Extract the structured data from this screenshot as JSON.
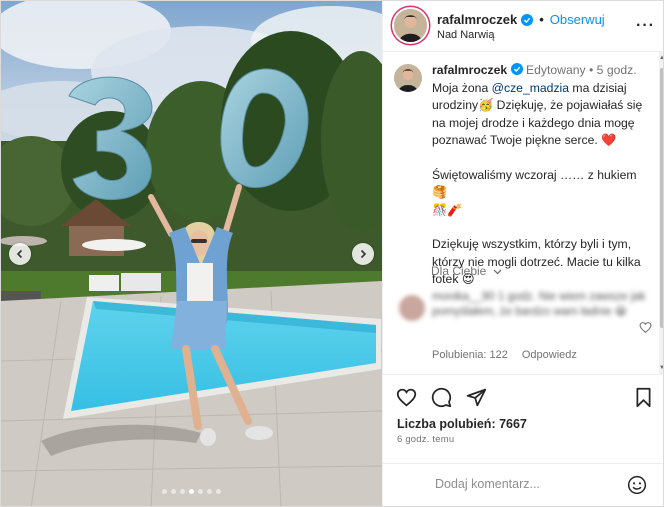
{
  "post": {
    "username": "rafalmroczek",
    "follow_label": "Obserwuj",
    "location": "Nad Narwią",
    "more_label": "···"
  },
  "caption": {
    "username": "rafalmroczek",
    "edited_label": "Edytowany",
    "time": "5 godz.",
    "line1_pre": "Moja żona ",
    "mention": "@cze_madzia",
    "line1_post": " ma dzisiaj urodziny",
    "emoji_birthday": "🥳",
    "line1_rest": " Dziękuję, że pojawiałaś się na mojej drodze i każdego dnia mogę poznawać Twoje piękne serce. ",
    "emoji_heart": "❤️",
    "para2": "Świętowaliśmy wczoraj …… z hukiem ",
    "emoji_cake": "🥞",
    "emoji_party": "🎊",
    "emoji_firecracker": "🧨",
    "para3": "Dziękuję wszystkim, którzy byli i tym, którzy nie mogli dotrzeć. Macie tu kilka fotek ",
    "emoji_smile": "😍"
  },
  "for_you_label": "Dla Ciebie",
  "comment2": {
    "text": "monika__90 1 godz. Nie wiem zawsze jak pomyślałem, że bardzo wam ładnie",
    "emoji": "😀",
    "likes_label": "Polubienia: 122",
    "reply_label": "Odpowiedz"
  },
  "likes": "Liczba polubień: 7667",
  "timestamp": "6 godz. temu",
  "comment_input": {
    "placeholder": "Dodaj komentarz..."
  },
  "carousel": {
    "slide_count": 7,
    "active_index": 3
  },
  "colors": {
    "accent": "#0095f6",
    "pool": "#3fc6e6",
    "balloon": "#78b4c8"
  }
}
